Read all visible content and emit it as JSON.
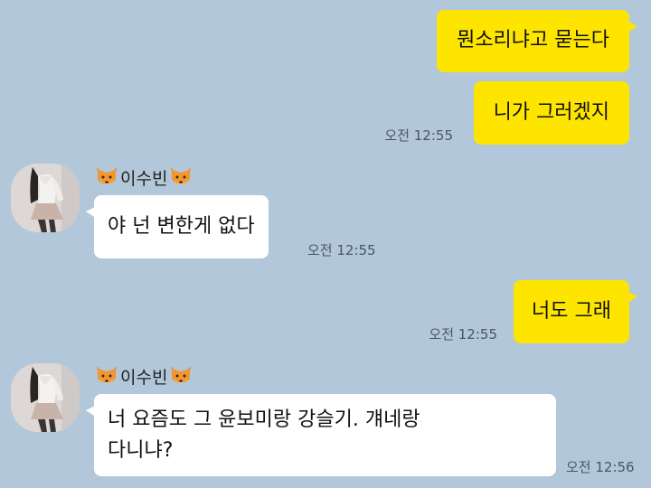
{
  "colors": {
    "background": "#b2c7da",
    "my_bubble": "#fee500",
    "their_bubble": "#ffffff"
  },
  "messages": [
    {
      "from": "me",
      "text": "뭔소리냐고 묻는다",
      "time": ""
    },
    {
      "from": "me",
      "text": "니가 그러겠지",
      "time": "오전 12:55"
    },
    {
      "from": "이수빈",
      "text": "야 넌 변한게 없다",
      "time": "오전 12:55"
    },
    {
      "from": "me",
      "text": "너도 그래",
      "time": "오전 12:55"
    },
    {
      "from": "이수빈",
      "lines": [
        "너 요즘도 그 윤보미랑 강슬기. 걔네랑",
        "다니냐?"
      ],
      "time": "오전 12:56"
    }
  ],
  "senders": [
    {
      "name": "이수빈",
      "emoji_icon": "fox-icon"
    },
    {
      "name": "이수빈",
      "emoji_icon": "fox-icon"
    }
  ]
}
